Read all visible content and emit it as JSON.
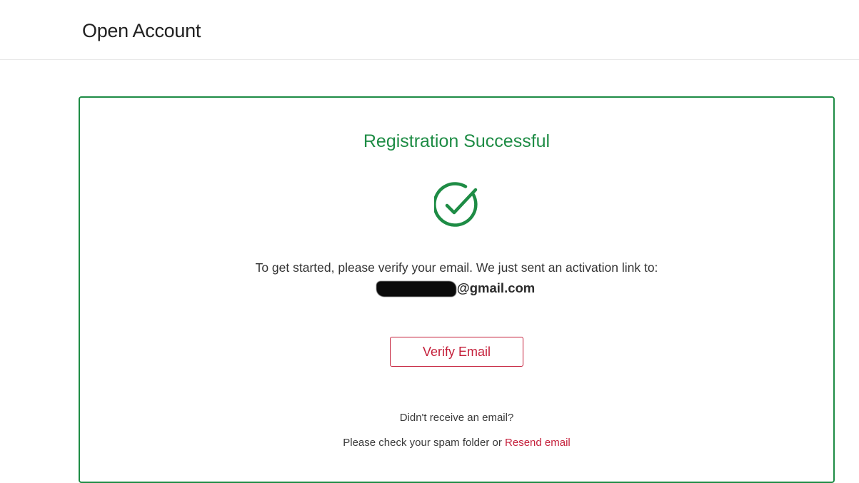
{
  "header": {
    "title": "Open Account"
  },
  "card": {
    "title": "Registration Successful",
    "icon": "check-circle-icon",
    "instruction": "To get started, please verify your email. We just sent an activation link to:",
    "email_suffix": "@gmail.com",
    "verify_button_label": "Verify Email",
    "no_email_text": "Didn't receive an email?",
    "spam_text": "Please check your spam folder or",
    "resend_label": "Resend email"
  },
  "colors": {
    "success_green": "#1e8c45",
    "accent_red": "#c41f3a",
    "text": "#333333"
  }
}
